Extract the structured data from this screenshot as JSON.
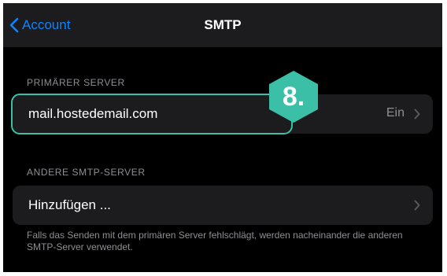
{
  "nav": {
    "back_label": "Account",
    "title": "SMTP"
  },
  "primary_server": {
    "header": "PRIMÄRER SERVER",
    "host": "mail.hostedemail.com",
    "status": "Ein"
  },
  "other_servers": {
    "header": "ANDERE SMTP-SERVER",
    "add_label": "Hinzufügen ...",
    "footer": "Falls das Senden mit dem primären Server fehlschlägt, werden nacheinander die anderen SMTP-Server verwendet."
  },
  "step_badge": {
    "label": "8.",
    "color": "#3bbfa7"
  },
  "colors": {
    "accent": "#0a84ff",
    "background": "#000000",
    "cell": "#1c1c1e",
    "secondary_text": "#8e8e93"
  }
}
